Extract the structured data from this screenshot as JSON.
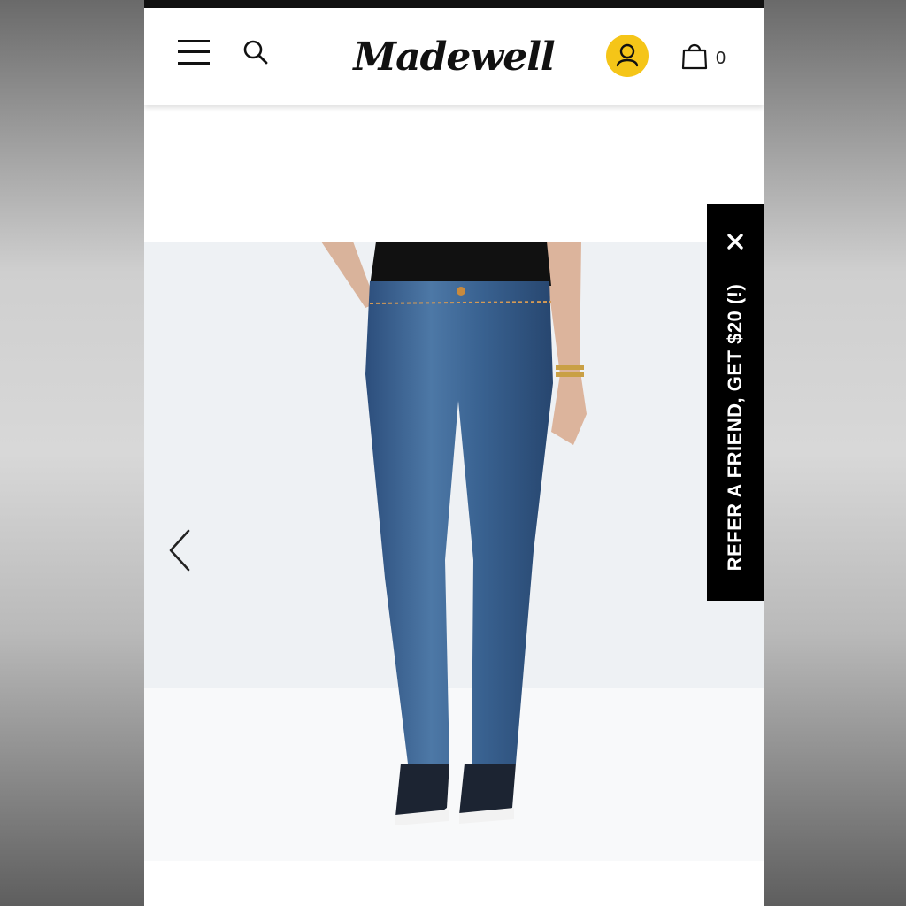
{
  "header": {
    "menu_icon": "hamburger-menu-icon",
    "search_icon": "search-icon",
    "logo_text": "Madewell",
    "account_icon": "user-icon",
    "account_color": "#f5c518",
    "bag_icon": "shopping-bag-icon",
    "bag_count": "0"
  },
  "carousel": {
    "prev_icon": "chevron-left-icon",
    "image_subject": "skinny jeans product photo"
  },
  "refer_tab": {
    "label": "REFER A FRIEND, GET $20 (!)",
    "close_icon": "close-icon",
    "background": "#000000"
  }
}
